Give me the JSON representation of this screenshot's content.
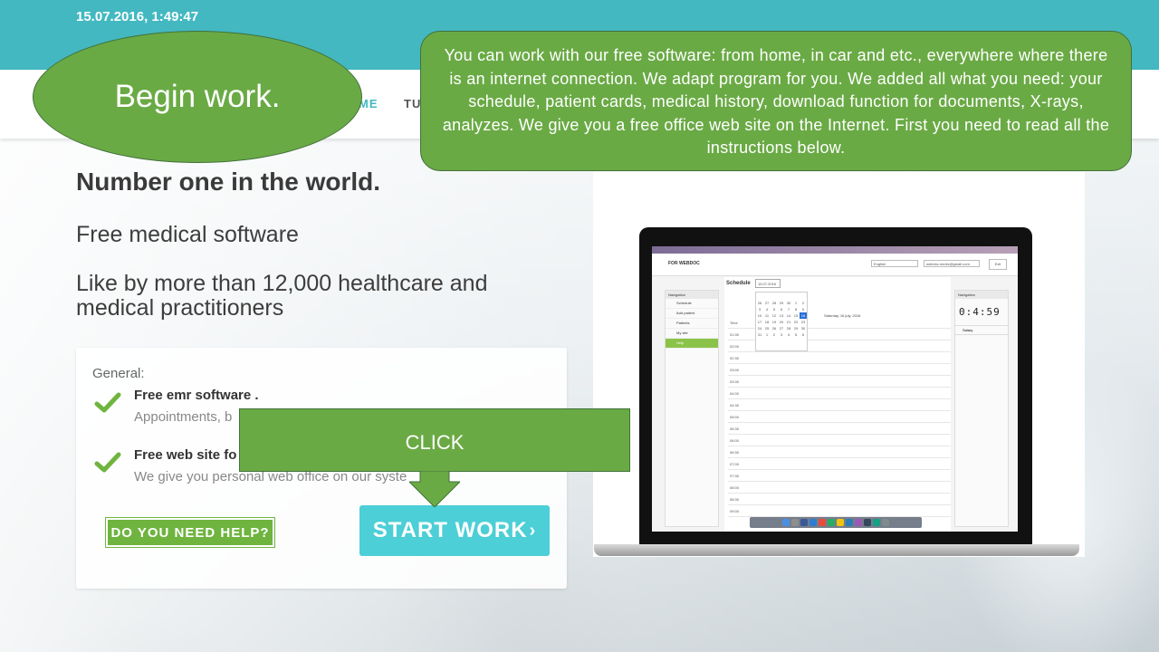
{
  "topbar": {
    "datetime": "15.07.2016, 1:49:47"
  },
  "nav": {
    "home": "ME",
    "tu": "TU"
  },
  "hero": {
    "title": "Number one in the world.",
    "subtitle": "Free medical software",
    "description": "Like by more than 12,000 healthcare and medical practitioners"
  },
  "card": {
    "general": "General:",
    "features": [
      {
        "title": "Free emr software .",
        "desc": "Appointments, b"
      },
      {
        "title": "Free web site fo",
        "desc": "We give you personal web office on our syste"
      }
    ]
  },
  "buttons": {
    "help": "DO YOU NEED HELP?",
    "start": "START WORK",
    "start_chevron": "›"
  },
  "overlays": {
    "begin": "Begin work.",
    "callout": "You can work with our free software:   from home,   in car and etc., everywhere  where there is an internet connection. We adapt program for you. We added all what you need: your schedule, patient cards, medical  history,  download function for documents, X-rays, analyzes. We give you a free office web site on the Internet. First you need to read all the instructions below.",
    "click": "CLICK"
  },
  "laptop": {
    "brand": "FOR WEBDOC",
    "lang": "English",
    "mail": "webdoc.medic@gmail.com",
    "exit": "Exit",
    "schedule": "Schedule",
    "date": "15.07.2016",
    "day_title": "Saturday, 16 july, 2016",
    "nav_header": "Navigation",
    "nav_items": [
      "Schedule",
      "Add patient",
      "Patients",
      "My site",
      "Help"
    ],
    "right_header": "Navigation",
    "clock": "0:4:59",
    "salary": "Salary",
    "times": [
      "Time",
      "01:30",
      "02:00",
      "02:30",
      "03:00",
      "03:30",
      "04:00",
      "04:30",
      "05:00",
      "05:30",
      "06:00",
      "06:30",
      "07:00",
      "07:30",
      "08:00",
      "08:30",
      "09:00"
    ],
    "calendar_days": [
      "26",
      "27",
      "28",
      "29",
      "30",
      "1",
      "2",
      "3",
      "4",
      "5",
      "6",
      "7",
      "8",
      "9",
      "10",
      "11",
      "12",
      "13",
      "14",
      "15",
      "16",
      "17",
      "18",
      "19",
      "20",
      "21",
      "22",
      "23",
      "24",
      "25",
      "26",
      "27",
      "28",
      "29",
      "30",
      "31",
      "1",
      "2",
      "3",
      "4",
      "5",
      "6"
    ],
    "calendar_today": "16"
  },
  "colors": {
    "teal": "#43b8c1",
    "green": "#6aaa45",
    "start": "#4ccfd6",
    "check": "#6fb43f"
  }
}
